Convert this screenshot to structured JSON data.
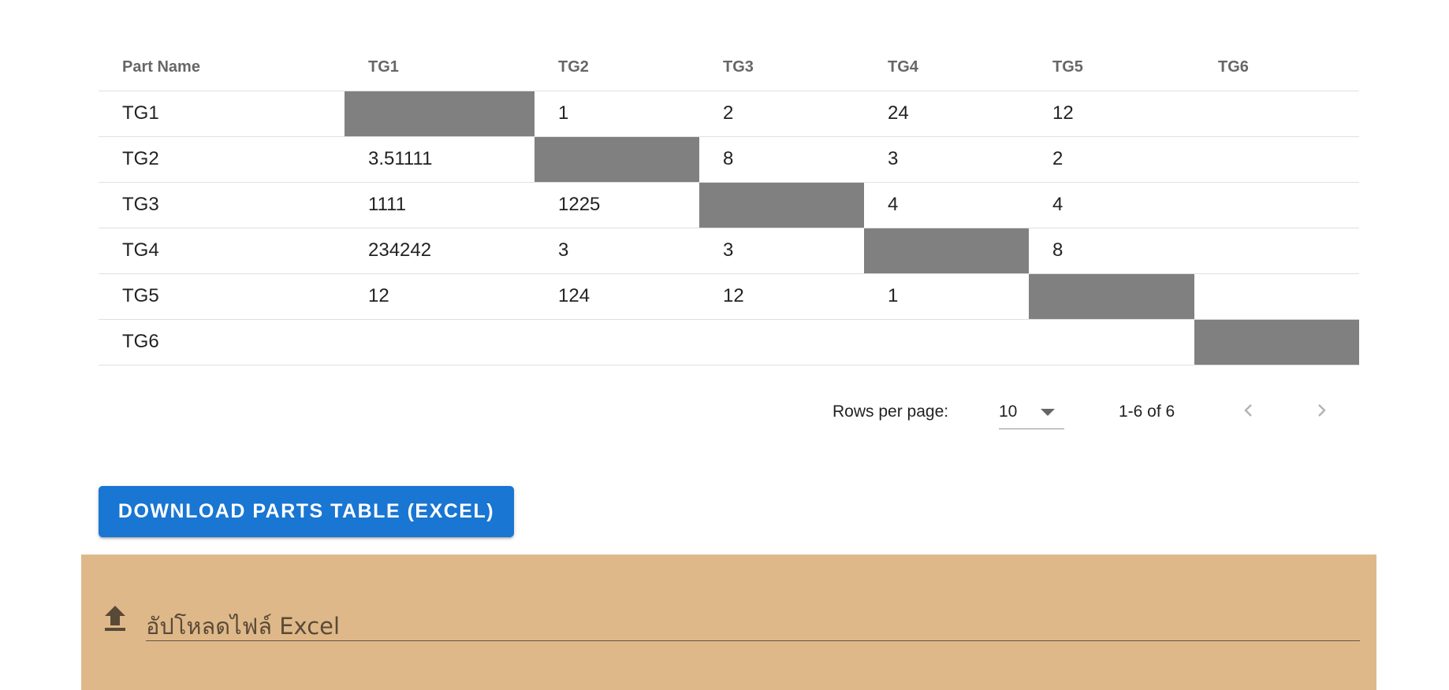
{
  "table": {
    "headers": [
      "Part Name",
      "TG1",
      "TG2",
      "TG3",
      "TG4",
      "TG5",
      "TG6"
    ],
    "rows": [
      {
        "name": "TG1",
        "cells": [
          "",
          "1",
          "2",
          "24",
          "12",
          ""
        ]
      },
      {
        "name": "TG2",
        "cells": [
          "3.51111",
          "",
          "8",
          "3",
          "2",
          ""
        ]
      },
      {
        "name": "TG3",
        "cells": [
          "1111",
          "1225",
          "",
          "4",
          "4",
          ""
        ]
      },
      {
        "name": "TG4",
        "cells": [
          "234242",
          "3",
          "3",
          "",
          "8",
          ""
        ]
      },
      {
        "name": "TG5",
        "cells": [
          "12",
          "124",
          "12",
          "1",
          "",
          ""
        ]
      },
      {
        "name": "TG6",
        "cells": [
          "",
          "",
          "",
          "",
          "",
          ""
        ]
      }
    ],
    "diagonal_fill_color": "#808080"
  },
  "pagination": {
    "rows_per_page_label": "Rows per page:",
    "rows_per_page_value": "10",
    "range_text": "1-6 of 6",
    "prev_icon": "chevron-left-icon",
    "next_icon": "chevron-right-icon"
  },
  "download_button": {
    "label": "DOWNLOAD PARTS TABLE (EXCEL)",
    "color": "#1976d2"
  },
  "upload": {
    "label": "อัปโหลดไฟล์ Excel",
    "icon": "upload-icon",
    "panel_color": "#dfb88a"
  }
}
